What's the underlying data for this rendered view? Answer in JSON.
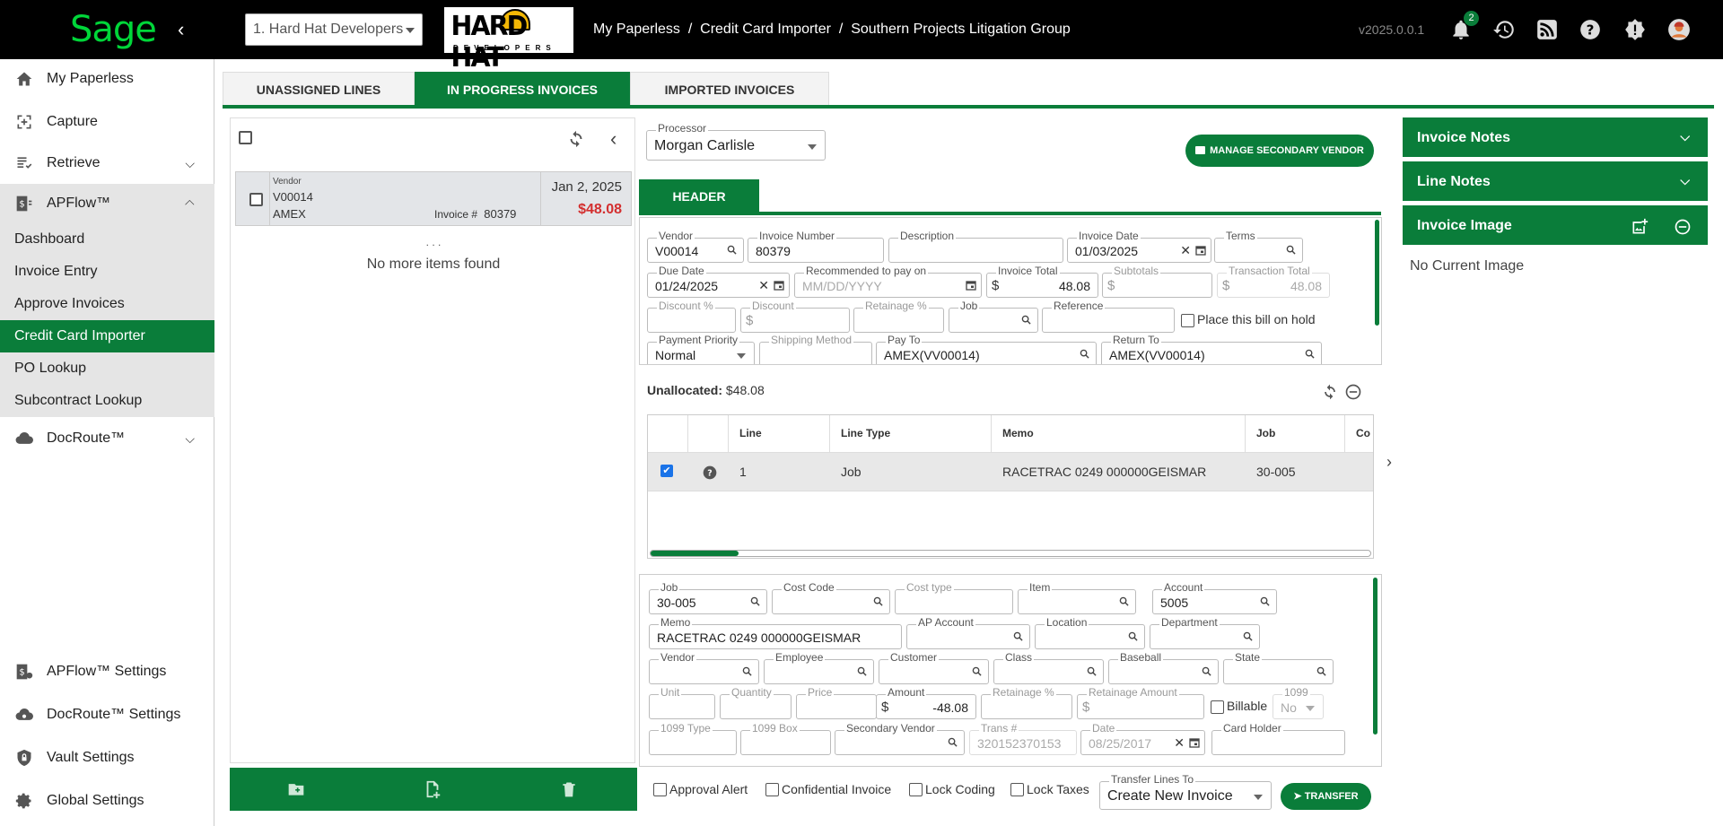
{
  "app": {
    "logo_text": "Sage",
    "brand_color": "#0a7d3a",
    "version": "v2025.0.0.1",
    "notification_count": "2"
  },
  "company": {
    "selected": "1. Hard Hat Developers",
    "logo_main": "HARD HAT",
    "logo_sub": "DEVELOPERS"
  },
  "breadcrumb": {
    "text": "My Paperless  /  Credit Card Importer  /  Southern Projects Litigation Group"
  },
  "sidebar": {
    "items": [
      {
        "label": "My Paperless",
        "icon": "home-icon"
      },
      {
        "label": "Capture",
        "icon": "capture-icon"
      },
      {
        "label": "Retrieve",
        "icon": "retrieve-icon"
      },
      {
        "label": "APFlow™",
        "icon": "apflow-icon"
      },
      {
        "label": "DocRoute™",
        "icon": "cloud-icon"
      }
    ],
    "apflow_sub": [
      "Dashboard",
      "Invoice Entry",
      "Approve Invoices",
      "Credit Card Importer",
      "PO Lookup",
      "Subcontract Lookup"
    ],
    "bottom": [
      "APFlow™ Settings",
      "DocRoute™ Settings",
      "Vault Settings",
      "Global Settings"
    ]
  },
  "tabs": [
    "UNASSIGNED LINES",
    "IN PROGRESS INVOICES",
    "IMPORTED INVOICES"
  ],
  "list": {
    "card": {
      "vendor_label": "Vendor",
      "vendor_code": "V00014",
      "vendor_name": "AMEX",
      "invoice_label": "Invoice #",
      "invoice_no": "80379",
      "date": "Jan 2, 2025",
      "amount": "$48.08"
    },
    "ellipsis": ". . .",
    "empty_text": "No more items found"
  },
  "processor": {
    "label": "Processor",
    "value": "Morgan Carlisle"
  },
  "manage_vendor_label": "MANAGE SECONDARY VENDOR",
  "header_tab": "HEADER",
  "header": {
    "vendor": {
      "label": "Vendor",
      "value": "V00014"
    },
    "invoice_number": {
      "label": "Invoice Number",
      "value": "80379"
    },
    "description": {
      "label": "Description",
      "value": ""
    },
    "invoice_date": {
      "label": "Invoice Date",
      "value": "01/03/2025"
    },
    "terms": {
      "label": "Terms",
      "value": ""
    },
    "due_date": {
      "label": "Due Date",
      "value": "01/24/2025"
    },
    "recommended": {
      "label": "Recommended to pay on",
      "placeholder": "MM/DD/YYYY"
    },
    "invoice_total": {
      "label": "Invoice Total",
      "value": "48.08"
    },
    "subtotals": {
      "label": "Subtotals",
      "value": ""
    },
    "transaction_total": {
      "label": "Transaction Total",
      "value": "48.08"
    },
    "discount_pct": {
      "label": "Discount %"
    },
    "discount": {
      "label": "Discount"
    },
    "retainage_pct": {
      "label": "Retainage %"
    },
    "job": {
      "label": "Job"
    },
    "reference": {
      "label": "Reference"
    },
    "hold_label": "Place this bill on hold",
    "payment_priority": {
      "label": "Payment Priority",
      "value": "Normal"
    },
    "shipping_method": {
      "label": "Shipping Method"
    },
    "pay_to": {
      "label": "Pay To",
      "value": "AMEX(VV00014)"
    },
    "return_to": {
      "label": "Return To",
      "value": "AMEX(VV00014)"
    }
  },
  "lines": {
    "unallocated_label": "Unallocated:",
    "unallocated_value": "$48.08",
    "columns": [
      "Line",
      "Line Type",
      "Memo",
      "Job",
      "Co"
    ],
    "rows": [
      {
        "line": "1",
        "type": "Job",
        "memo": "RACETRAC 0249 000000GEISMAR",
        "job": "30-005"
      }
    ]
  },
  "detail": {
    "job": {
      "label": "Job",
      "value": "30-005"
    },
    "cost_code": {
      "label": "Cost Code"
    },
    "cost_type": {
      "label": "Cost type"
    },
    "item": {
      "label": "Item"
    },
    "account": {
      "label": "Account",
      "value": "5005"
    },
    "memo": {
      "label": "Memo",
      "value": "RACETRAC 0249 000000GEISMAR"
    },
    "ap_account": {
      "label": "AP Account"
    },
    "location": {
      "label": "Location"
    },
    "department": {
      "label": "Department"
    },
    "vendor": {
      "label": "Vendor"
    },
    "employee": {
      "label": "Employee"
    },
    "customer": {
      "label": "Customer"
    },
    "class": {
      "label": "Class"
    },
    "baseball": {
      "label": "Baseball"
    },
    "state": {
      "label": "State"
    },
    "unit": {
      "label": "Unit"
    },
    "quantity": {
      "label": "Quantity"
    },
    "price": {
      "label": "Price"
    },
    "amount": {
      "label": "Amount",
      "value": "-48.08"
    },
    "retainage_pct": {
      "label": "Retainage %"
    },
    "retainage_amount": {
      "label": "Retainage Amount"
    },
    "billable_label": "Billable",
    "t1099": {
      "label": "1099",
      "value": "No"
    },
    "t1099_type": {
      "label": "1099 Type"
    },
    "t1099_box": {
      "label": "1099 Box"
    },
    "secondary_vendor": {
      "label": "Secondary Vendor"
    },
    "trans_no": {
      "label": "Trans #",
      "value": "320152370153"
    },
    "date": {
      "label": "Date",
      "value": "08/25/2017"
    },
    "card_holder": {
      "label": "Card Holder"
    }
  },
  "footer": {
    "approval_alert": "Approval Alert",
    "confidential": "Confidential Invoice",
    "lock_coding": "Lock Coding",
    "lock_taxes": "Lock Taxes",
    "transfer_to": {
      "label": "Transfer Lines To",
      "value": "Create New Invoice"
    },
    "transfer_button": "TRANSFER"
  },
  "right_panel": {
    "invoice_notes": "Invoice Notes",
    "line_notes": "Line Notes",
    "invoice_image": "Invoice Image",
    "no_image": "No Current Image"
  }
}
